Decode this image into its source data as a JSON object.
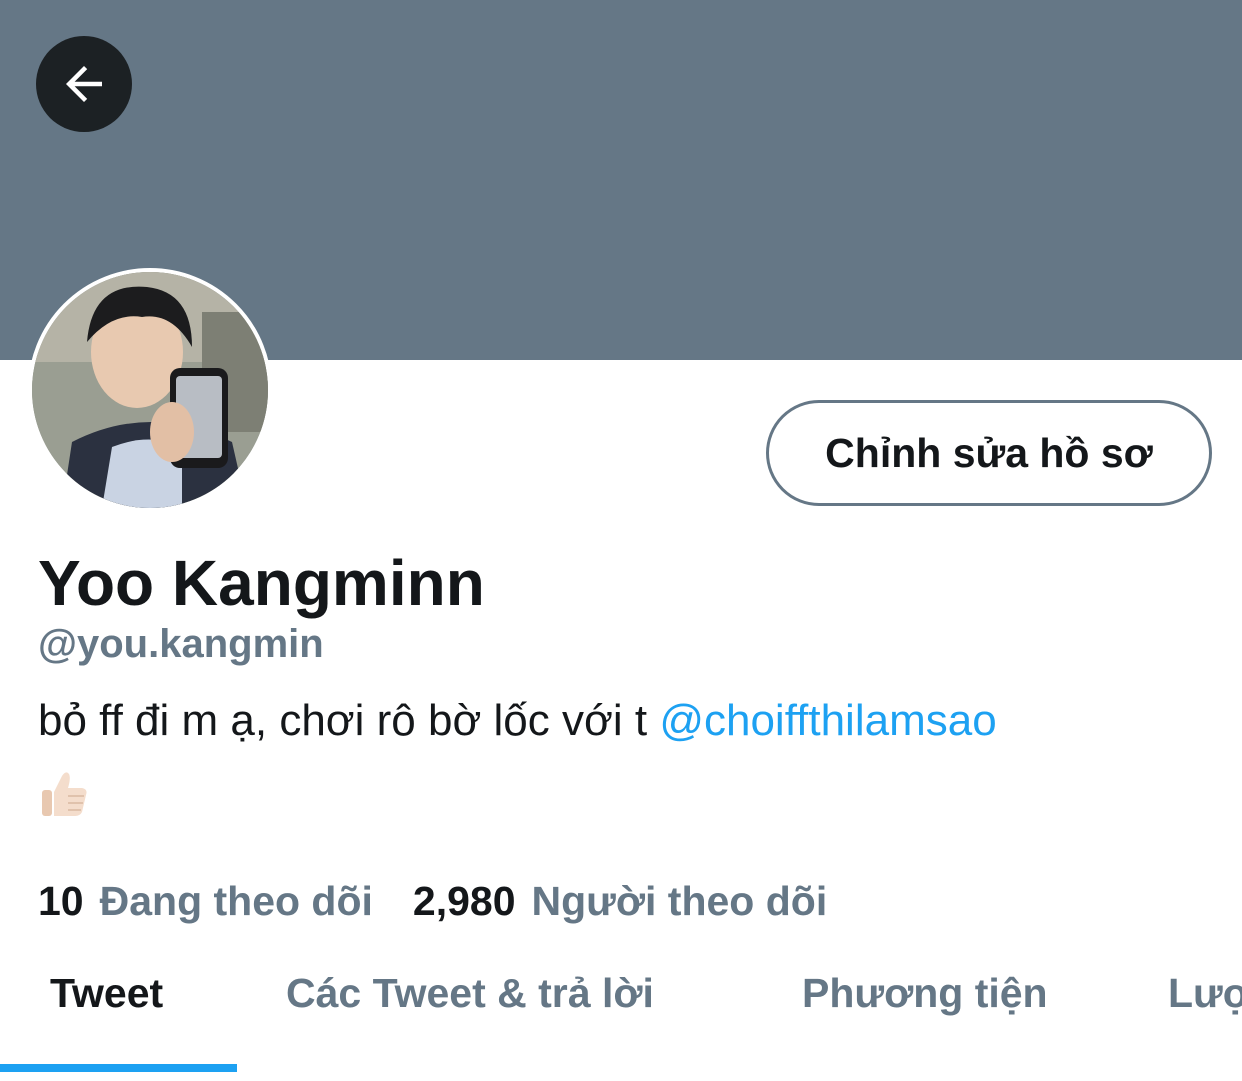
{
  "header": {
    "back_icon": "arrow-left-icon",
    "banner_color": "#657786"
  },
  "profile": {
    "display_name": "Yoo Kangminn",
    "handle": "@you.kangmin",
    "edit_button_label": "Chỉnh sửa hồ sơ",
    "bio_text": "bỏ ff đi m ạ, chơi rô bờ lốc với t ",
    "bio_mention": "@choiffthilamsao",
    "bio_emoji": "thumbs-up-icon"
  },
  "stats": {
    "following_count": "10",
    "following_label": "Đang theo dõi",
    "followers_count": "2,980",
    "followers_label": "Người theo dõi"
  },
  "tabs": [
    {
      "label": "Tweet",
      "active": true
    },
    {
      "label": "Các Tweet & trả lời",
      "active": false
    },
    {
      "label": "Phương tiện",
      "active": false
    },
    {
      "label": "Lượ",
      "active": false
    }
  ],
  "colors": {
    "accent": "#1da1f2",
    "text_primary": "#14171a",
    "text_secondary": "#657786"
  }
}
